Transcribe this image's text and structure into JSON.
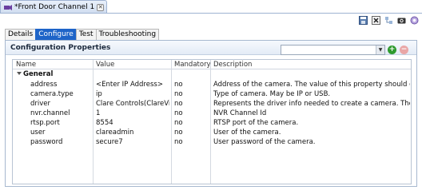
{
  "editor_tab": {
    "title": "*Front Door Channel 1",
    "close": "✕"
  },
  "subtabs": [
    "Details",
    "Configure",
    "Test",
    "Troubleshooting"
  ],
  "active_subtab": "Configure",
  "section": {
    "title": "Configuration Properties",
    "combo_value": "",
    "add": "+",
    "remove": "−"
  },
  "table": {
    "headers": [
      "Name",
      "Value",
      "Mandatory",
      "Description"
    ],
    "group": "General",
    "rows": [
      {
        "name": "address",
        "value": "<Enter IP Address>",
        "mandatory": "no",
        "description": "Address of the camera. The value of this property should co"
      },
      {
        "name": "camera.type",
        "value": "ip",
        "mandatory": "no",
        "description": "Type of camera. May be IP or USB."
      },
      {
        "name": "driver",
        "value": "Clare Controls(ClareVis",
        "mandatory": "no",
        "description": "Represents the driver info needed to create a camera. The"
      },
      {
        "name": "nvr.channel",
        "value": "1",
        "mandatory": "no",
        "description": "NVR Channel Id"
      },
      {
        "name": "rtsp.port",
        "value": "8554",
        "mandatory": "no",
        "description": "RTSP port of the camera."
      },
      {
        "name": "user",
        "value": "clareadmin",
        "mandatory": "no",
        "description": "User of the camera."
      },
      {
        "name": "password",
        "value": "secure7",
        "mandatory": "no",
        "description": "User password of the camera."
      }
    ]
  },
  "colors": {
    "active_tab": "#1e64c8",
    "header_border": "#a7b8cf"
  }
}
